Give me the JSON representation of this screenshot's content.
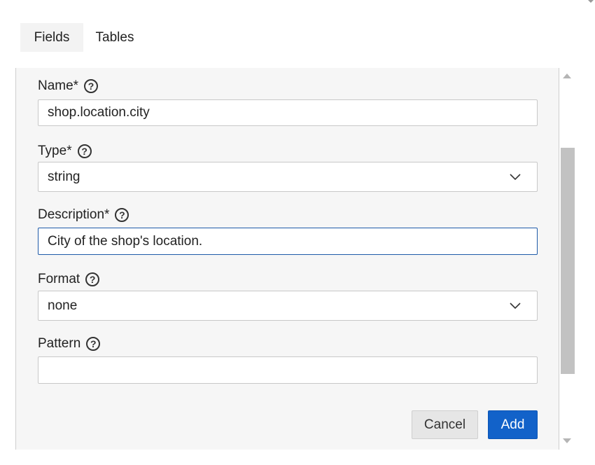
{
  "tabs": [
    {
      "label": "Fields",
      "active": true
    },
    {
      "label": "Tables",
      "active": false
    }
  ],
  "form": {
    "name": {
      "label": "Name*",
      "value": "shop.location.city"
    },
    "type": {
      "label": "Type*",
      "value": "string"
    },
    "description": {
      "label": "Description*",
      "value": "City of the shop's location."
    },
    "format": {
      "label": "Format",
      "value": "none"
    },
    "pattern": {
      "label": "Pattern",
      "value": ""
    }
  },
  "buttons": {
    "cancel": "Cancel",
    "add": "Add"
  },
  "help_glyph": "?",
  "colors": {
    "accent": "#1262c9",
    "focus_border": "#1e5aa8",
    "panel_bg": "#f6f6f6",
    "scroll_thumb": "#c2c2c2"
  },
  "icons": {
    "help": "question-circle-icon",
    "dropdown": "chevron-down-icon",
    "scroll_up": "triangle-up-icon",
    "scroll_down": "triangle-down-icon"
  }
}
